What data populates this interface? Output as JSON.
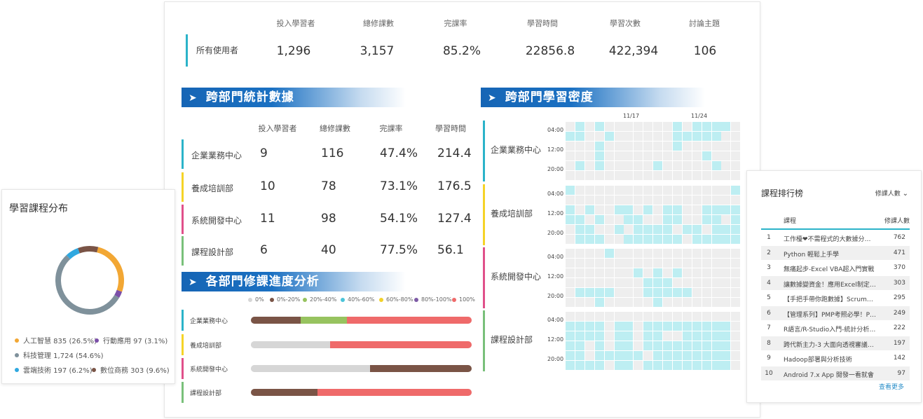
{
  "summary": {
    "headers": [
      "投入學習者",
      "總修課數",
      "完課率",
      "學習時間",
      "學習次數",
      "討論主題"
    ],
    "row_label": "所有使用者",
    "values": [
      "1,296",
      "3,157",
      "85.2%",
      "22856.8",
      "422,394",
      "106"
    ]
  },
  "dept_stats": {
    "title": "跨部門統計數據",
    "headers": [
      "投入學習者",
      "總修課數",
      "完課率",
      "學習時間"
    ],
    "rows": [
      {
        "name": "企業業務中心",
        "values": [
          "9",
          "116",
          "47.4%",
          "214.4"
        ],
        "color": "#2bb3c9"
      },
      {
        "name": "養成培訓部",
        "values": [
          "10",
          "78",
          "73.1%",
          "176.5"
        ],
        "color": "#f5d327"
      },
      {
        "name": "系統開發中心",
        "values": [
          "11",
          "98",
          "54.1%",
          "127.4"
        ],
        "color": "#e0508a"
      },
      {
        "name": "課程設計部",
        "values": [
          "6",
          "40",
          "77.5%",
          "56.1"
        ],
        "color": "#79c07a"
      }
    ]
  },
  "progress": {
    "title": "各部門修課進度分析",
    "legend": [
      {
        "label": "0%",
        "color": "#d6d6d6"
      },
      {
        "label": "0%-20%",
        "color": "#7a5446"
      },
      {
        "label": "20%-40%",
        "color": "#97c35f"
      },
      {
        "label": "40%-60%",
        "color": "#4bc4d9"
      },
      {
        "label": "60%-80%",
        "color": "#f2d129"
      },
      {
        "label": "80%-100%",
        "color": "#7d5ba6"
      },
      {
        "label": "100%",
        "color": "#ef6a6a"
      }
    ],
    "rows": [
      {
        "name": "企業業務中心",
        "color": "#2bb3c9",
        "segments": [
          {
            "color": "#7a5446",
            "pct": 22.5
          },
          {
            "color": "#97c35f",
            "pct": 21
          },
          {
            "color": "#ef6a6a",
            "pct": 56.5
          }
        ]
      },
      {
        "name": "養成培訓部",
        "color": "#f5d327",
        "segments": [
          {
            "color": "#d6d6d6",
            "pct": 36
          },
          {
            "color": "#ef6a6a",
            "pct": 64
          }
        ]
      },
      {
        "name": "系統開發中心",
        "color": "#e0508a",
        "segments": [
          {
            "color": "#d6d6d6",
            "pct": 54
          },
          {
            "color": "#7a5446",
            "pct": 46
          }
        ]
      },
      {
        "name": "課程設計部",
        "color": "#79c07a",
        "segments": [
          {
            "color": "#7a5446",
            "pct": 30
          },
          {
            "color": "#ef6a6a",
            "pct": 70
          }
        ]
      }
    ]
  },
  "density": {
    "title": "跨部門學習密度",
    "dates": [
      "11/17",
      "11/24"
    ],
    "times": [
      "04:00",
      "12:00",
      "20:00"
    ],
    "active_color": "#bdeef2",
    "empty_color": "#eeeeee",
    "rows": [
      {
        "name": "企業業務中心",
        "color": "#2bb3c9",
        "active": [
          [
            1,
            0
          ],
          [
            3,
            0
          ],
          [
            11,
            0
          ],
          [
            13,
            0
          ],
          [
            14,
            0
          ],
          [
            15,
            0
          ],
          [
            16,
            0
          ],
          [
            0,
            1
          ],
          [
            1,
            1
          ],
          [
            4,
            1
          ],
          [
            11,
            1
          ],
          [
            12,
            1
          ],
          [
            13,
            1
          ],
          [
            14,
            1
          ],
          [
            15,
            1
          ],
          [
            3,
            2
          ],
          [
            11,
            2
          ],
          [
            3,
            3
          ],
          [
            14,
            3
          ],
          [
            1,
            4
          ],
          [
            3,
            4
          ],
          [
            9,
            4
          ],
          [
            15,
            4
          ]
        ]
      },
      {
        "name": "養成培訓部",
        "color": "#f5d327",
        "active": [
          [
            0,
            0
          ],
          [
            17,
            0
          ],
          [
            0,
            2
          ],
          [
            2,
            2
          ],
          [
            5,
            2
          ],
          [
            6,
            2
          ],
          [
            8,
            2
          ],
          [
            10,
            2
          ],
          [
            11,
            2
          ],
          [
            14,
            2
          ],
          [
            15,
            2
          ],
          [
            16,
            2
          ],
          [
            17,
            2
          ],
          [
            0,
            3
          ],
          [
            1,
            3
          ],
          [
            3,
            3
          ],
          [
            6,
            3
          ],
          [
            7,
            3
          ],
          [
            10,
            3
          ],
          [
            11,
            3
          ],
          [
            14,
            3
          ],
          [
            15,
            3
          ],
          [
            17,
            3
          ],
          [
            1,
            4
          ],
          [
            2,
            4
          ],
          [
            5,
            4
          ],
          [
            7,
            4
          ],
          [
            8,
            4
          ],
          [
            9,
            4
          ],
          [
            10,
            4
          ],
          [
            12,
            4
          ],
          [
            13,
            4
          ],
          [
            15,
            4
          ],
          [
            16,
            4
          ],
          [
            17,
            4
          ],
          [
            1,
            5
          ],
          [
            2,
            5
          ],
          [
            3,
            5
          ],
          [
            6,
            5
          ],
          [
            7,
            5
          ],
          [
            8,
            5
          ],
          [
            9,
            5
          ],
          [
            10,
            5
          ],
          [
            11,
            5
          ],
          [
            13,
            5
          ],
          [
            14,
            5
          ],
          [
            15,
            5
          ],
          [
            16,
            5
          ],
          [
            17,
            5
          ]
        ]
      },
      {
        "name": "系統開發中心",
        "color": "#e0508a",
        "active": [
          [
            4,
            0
          ],
          [
            7,
            2
          ],
          [
            9,
            2
          ],
          [
            11,
            2
          ],
          [
            8,
            3
          ],
          [
            9,
            3
          ],
          [
            10,
            3
          ],
          [
            1,
            4
          ],
          [
            2,
            4
          ],
          [
            3,
            4
          ],
          [
            4,
            4
          ],
          [
            8,
            4
          ],
          [
            9,
            4
          ],
          [
            10,
            4
          ],
          [
            11,
            4
          ],
          [
            12,
            4
          ],
          [
            3,
            5
          ],
          [
            9,
            5
          ]
        ]
      },
      {
        "name": "課程設計部",
        "color": "#79c07a",
        "active": [
          [
            0,
            1
          ],
          [
            1,
            1
          ],
          [
            2,
            1
          ],
          [
            3,
            1
          ],
          [
            5,
            1
          ],
          [
            6,
            1
          ],
          [
            8,
            1
          ],
          [
            9,
            1
          ],
          [
            10,
            1
          ],
          [
            11,
            1
          ],
          [
            12,
            1
          ],
          [
            13,
            1
          ],
          [
            14,
            1
          ],
          [
            15,
            1
          ],
          [
            16,
            1
          ],
          [
            0,
            2
          ],
          [
            1,
            2
          ],
          [
            2,
            2
          ],
          [
            3,
            2
          ],
          [
            5,
            2
          ],
          [
            6,
            2
          ],
          [
            8,
            2
          ],
          [
            9,
            2
          ],
          [
            12,
            2
          ],
          [
            13,
            2
          ],
          [
            14,
            2
          ],
          [
            15,
            2
          ],
          [
            16,
            2
          ],
          [
            0,
            3
          ],
          [
            1,
            3
          ],
          [
            3,
            3
          ],
          [
            5,
            3
          ],
          [
            6,
            3
          ],
          [
            8,
            3
          ],
          [
            9,
            3
          ],
          [
            10,
            3
          ],
          [
            11,
            3
          ],
          [
            12,
            3
          ],
          [
            13,
            3
          ],
          [
            14,
            3
          ],
          [
            15,
            3
          ],
          [
            16,
            3
          ],
          [
            0,
            4
          ],
          [
            1,
            4
          ],
          [
            3,
            4
          ],
          [
            4,
            4
          ],
          [
            5,
            4
          ],
          [
            6,
            4
          ],
          [
            7,
            4
          ],
          [
            9,
            4
          ],
          [
            10,
            4
          ],
          [
            11,
            4
          ],
          [
            12,
            4
          ],
          [
            13,
            4
          ],
          [
            14,
            4
          ],
          [
            15,
            4
          ],
          [
            16,
            4
          ],
          [
            0,
            5
          ],
          [
            1,
            5
          ],
          [
            2,
            5
          ],
          [
            3,
            5
          ],
          [
            5,
            5
          ],
          [
            6,
            5
          ],
          [
            8,
            5
          ],
          [
            9,
            5
          ],
          [
            10,
            5
          ],
          [
            11,
            5
          ],
          [
            12,
            5
          ],
          [
            13,
            5
          ],
          [
            14,
            5
          ],
          [
            15,
            5
          ],
          [
            16,
            5
          ]
        ]
      }
    ]
  },
  "distribution": {
    "title": "學習課程分布",
    "chart_data": {
      "type": "pie",
      "slices": [
        {
          "label": "人工智慧",
          "value": 835,
          "pct": "26.5%",
          "color": "#f2a734"
        },
        {
          "label": "行動應用",
          "value": 97,
          "pct": "3.1%",
          "color": "#7b4fa8"
        },
        {
          "label": "科技管理",
          "value": 1724,
          "pct": "54.6%",
          "color": "#7f919b"
        },
        {
          "label": "雲端技術",
          "value": 197,
          "pct": "6.2%",
          "color": "#2fa8e0"
        },
        {
          "label": "數位商務",
          "value": 303,
          "pct": "9.6%",
          "color": "#7a5446"
        }
      ]
    },
    "legend": [
      {
        "text": "人工智慧 835 (26.5%)",
        "color": "#f2a734"
      },
      {
        "text": "行動應用 97 (3.1%)",
        "color": "#7b4fa8"
      },
      {
        "text": "科技管理 1,724 (54.6%)",
        "color": "#7f919b"
      },
      {
        "text": "雲端技術 197 (6.2%)",
        "color": "#2fa8e0"
      },
      {
        "text": "數位商務 303 (9.6%)",
        "color": "#7a5446"
      }
    ]
  },
  "ranking": {
    "title": "課程排行榜",
    "sort_label": "修課人數",
    "col_course": "課程",
    "col_count": "修課人數",
    "rows": [
      {
        "rank": "1",
        "name": "工作檯❤不需程式的大數據分…",
        "count": "762"
      },
      {
        "rank": "2",
        "name": "Python 輕鬆上手學",
        "count": "471"
      },
      {
        "rank": "3",
        "name": "無痛起步-Excel VBA超入門實戰",
        "count": "370"
      },
      {
        "rank": "4",
        "name": "讓數據變資金！應用Excel制定…",
        "count": "303"
      },
      {
        "rank": "5",
        "name": "【手把手帶你跑數據】Scrum…",
        "count": "295"
      },
      {
        "rank": "6",
        "name": "【管理系列】PMP考照必學！P…",
        "count": "249"
      },
      {
        "rank": "7",
        "name": "R語言/R-Studio入門-統計分析…",
        "count": "222"
      },
      {
        "rank": "8",
        "name": "跨代新主力-3 大面向透視審議…",
        "count": "197"
      },
      {
        "rank": "9",
        "name": "Hadoop部署與分析技術",
        "count": "142"
      },
      {
        "rank": "10",
        "name": "Android 7.x App 開發一看就會",
        "count": "97"
      }
    ],
    "more_label": "查看更多"
  }
}
